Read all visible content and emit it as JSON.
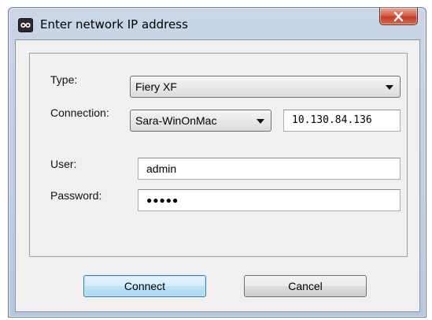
{
  "window": {
    "title": "Enter network IP address",
    "close_glyph": "X"
  },
  "form": {
    "type_label": "Type:",
    "type_value": "Fiery XF",
    "connection_label": "Connection:",
    "connection_value": "Sara-WinOnMac",
    "ip_value": "10.130.84.136",
    "user_label": "User:",
    "user_value": "admin",
    "password_label": "Password:",
    "password_value": "●●●●●"
  },
  "buttons": {
    "connect_label": "Connect",
    "cancel_label": "Cancel"
  },
  "colors": {
    "titlebar": "#b8c8dc",
    "close_button": "#c1402a",
    "default_button_border": "#3c7fb1"
  },
  "icons": [
    "app-logo-icon",
    "close-icon",
    "chevron-down-icon"
  ]
}
